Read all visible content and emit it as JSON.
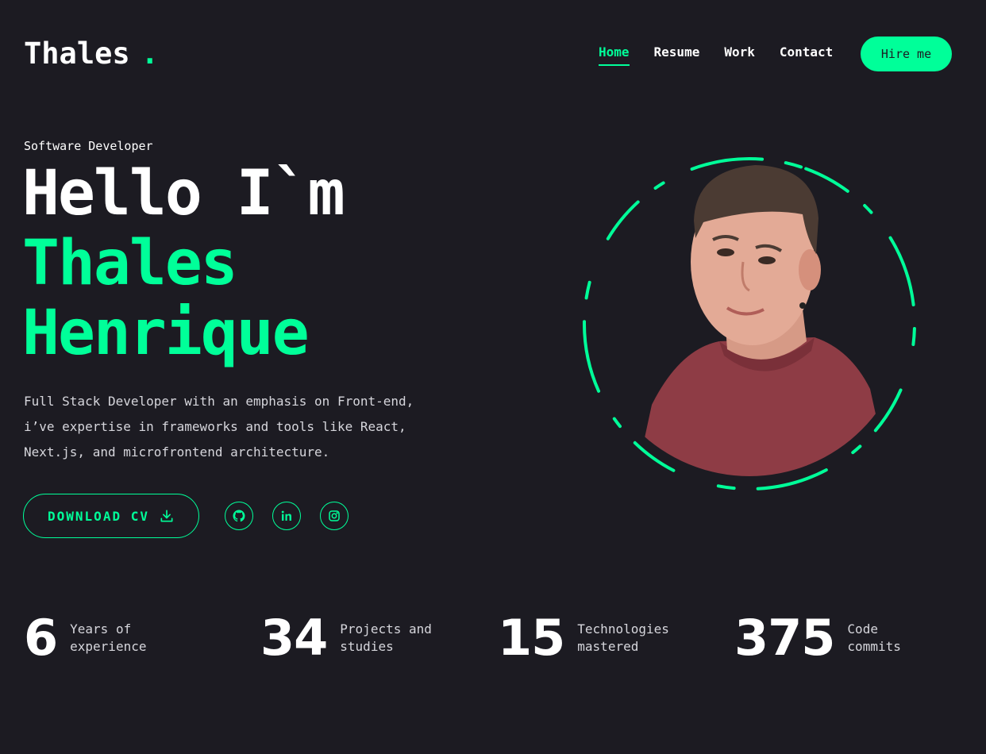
{
  "brand": {
    "name": "Thales",
    "dot": "."
  },
  "nav": {
    "items": [
      {
        "label": "Home",
        "active": true
      },
      {
        "label": "Resume",
        "active": false
      },
      {
        "label": "Work",
        "active": false
      },
      {
        "label": "Contact",
        "active": false
      }
    ],
    "cta": "Hire me"
  },
  "hero": {
    "subtitle": "Software Developer",
    "greeting": "Hello I`m",
    "first_name": "Thales",
    "last_name": "Henrique",
    "description": "Full Stack Developer with an emphasis on Front-end, i’ve expertise in frameworks and tools like React, Next.js, and microfrontend architecture.",
    "download_label": "DOWNLOAD CV",
    "download_icon": "download-icon",
    "socials": [
      {
        "name": "github",
        "icon": "github-icon"
      },
      {
        "name": "linkedin",
        "icon": "linkedin-icon"
      },
      {
        "name": "instagram",
        "icon": "instagram-icon"
      }
    ]
  },
  "stats": [
    {
      "value": "6",
      "label": "Years of experience"
    },
    {
      "value": "34",
      "label": "Projects and studies"
    },
    {
      "value": "15",
      "label": "Technologies mastered"
    },
    {
      "value": "375",
      "label": "Code commits"
    }
  ],
  "colors": {
    "background": "#1c1b22",
    "accent": "#00ff99",
    "text": "#ffffff",
    "muted_text": "#d6d6dc"
  }
}
